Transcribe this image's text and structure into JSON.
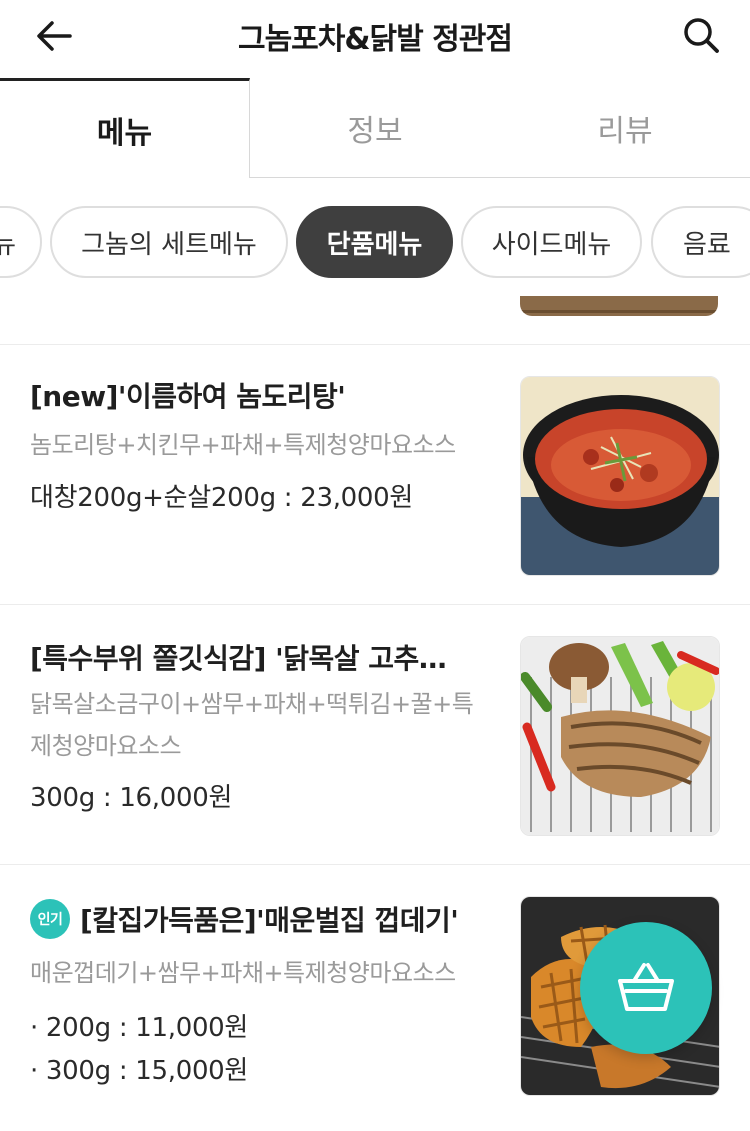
{
  "header": {
    "title": "그놈포차&닭발 정관점",
    "back_icon": "arrow-left-icon",
    "search_icon": "search-icon"
  },
  "tabs": [
    {
      "label": "메뉴",
      "active": true
    },
    {
      "label": "정보",
      "active": false
    },
    {
      "label": "리뷰",
      "active": false
    }
  ],
  "categories": [
    {
      "label": "뉴",
      "active": false
    },
    {
      "label": "그놈의 세트메뉴",
      "active": false
    },
    {
      "label": "단품메뉴",
      "active": true
    },
    {
      "label": "사이드메뉴",
      "active": false
    },
    {
      "label": "음료",
      "active": false
    }
  ],
  "menu_items": [
    {
      "name": "[new]'이름하여 놈도리탕'",
      "description": "놈도리탕+치킨무+파채+특제청양마요소스",
      "prices": [
        "대창200g+순살200g : 23,000원"
      ],
      "popular": false
    },
    {
      "name": "[특수부위 쫄깃식감] '닭목살 고추…",
      "description": "닭목살소금구이+쌈무+파채+떡튀김+꿀+특제청양마요소스",
      "prices": [
        "300g : 16,000원"
      ],
      "popular": false
    },
    {
      "name": "[칼집가득품은]'매운벌집 껍데기'",
      "description": "매운껍데기+쌈무+파채+특제청양마요소스",
      "prices": [
        "· 200g : 11,000원",
        "· 300g : 15,000원"
      ],
      "popular": true,
      "badge_label": "인기"
    }
  ],
  "cart": {
    "icon": "basket-icon"
  },
  "colors": {
    "accent": "#2cc2b8",
    "chip_active": "#3f3f3f",
    "muted_text": "#9a9a9a"
  }
}
